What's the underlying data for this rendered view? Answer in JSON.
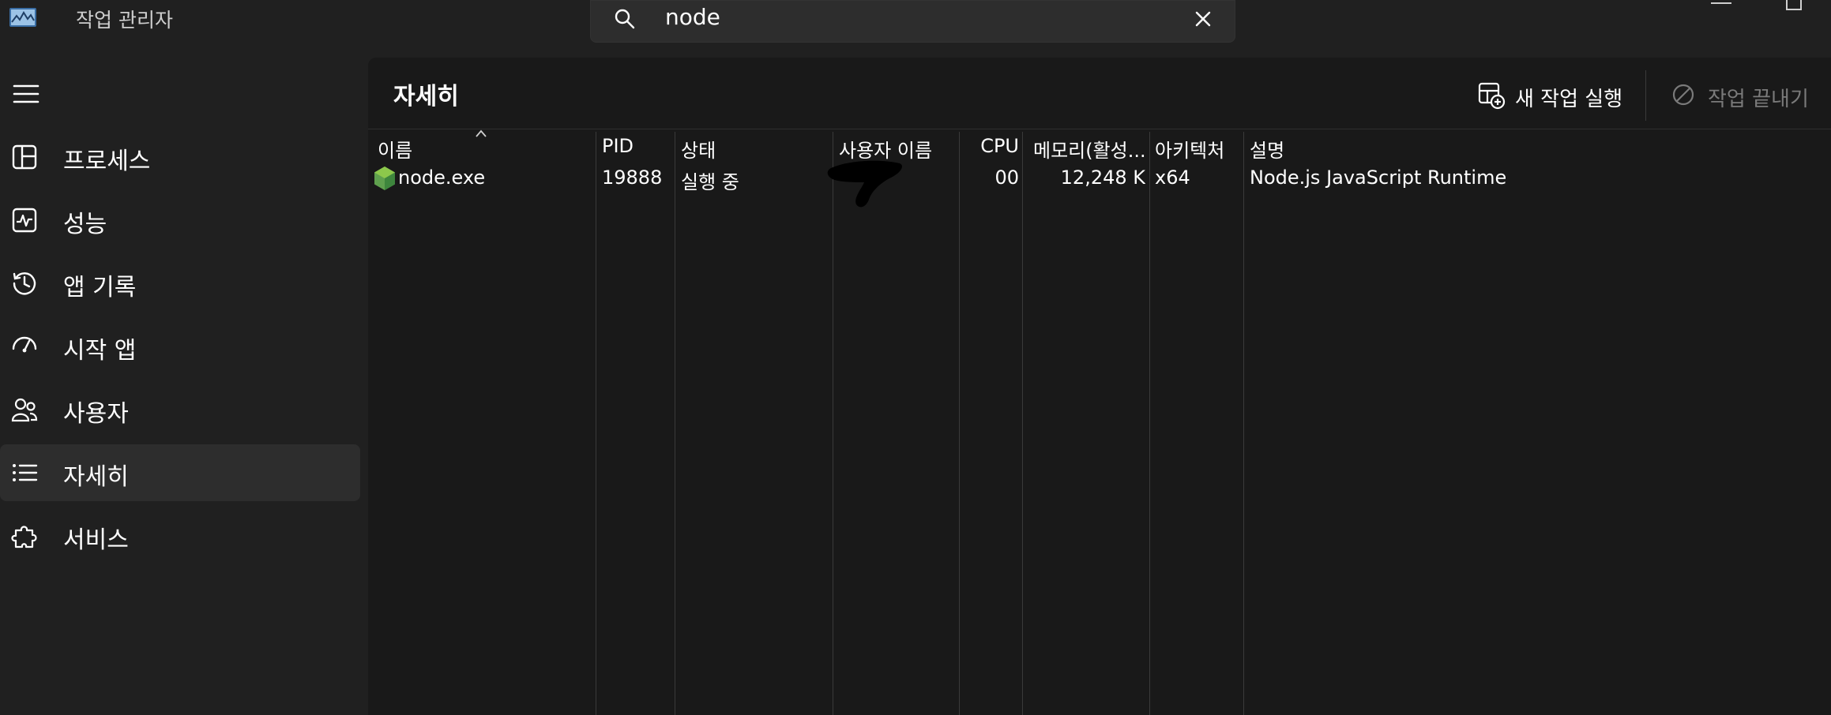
{
  "titlebar": {
    "app_title": "작업 관리자",
    "search_value": "node"
  },
  "sidebar": {
    "items": [
      {
        "label": "프로세스",
        "icon": "processes-icon"
      },
      {
        "label": "성능",
        "icon": "performance-icon"
      },
      {
        "label": "앱 기록",
        "icon": "app-history-icon"
      },
      {
        "label": "시작 앱",
        "icon": "startup-apps-icon"
      },
      {
        "label": "사용자",
        "icon": "users-icon"
      },
      {
        "label": "자세히",
        "icon": "details-icon",
        "selected": true
      },
      {
        "label": "서비스",
        "icon": "services-icon"
      }
    ]
  },
  "main": {
    "title": "자세히",
    "run_new_task": "새 작업 실행",
    "end_task": "작업 끝내기"
  },
  "table": {
    "columns": [
      "이름",
      "PID",
      "상태",
      "사용자 이름",
      "CPU",
      "메모리(활성...",
      "아키텍처",
      "설명"
    ],
    "rows": [
      {
        "name": "node.exe",
        "pid": "19888",
        "status": "실행 중",
        "user": "",
        "cpu": "00",
        "memory": "12,248 K",
        "arch": "x64",
        "description": "Node.js JavaScript Runtime"
      }
    ]
  },
  "colors": {
    "background": "#202020",
    "panel": "#191919",
    "selected": "#2d2d2d",
    "node_green": "#5fa04e"
  }
}
